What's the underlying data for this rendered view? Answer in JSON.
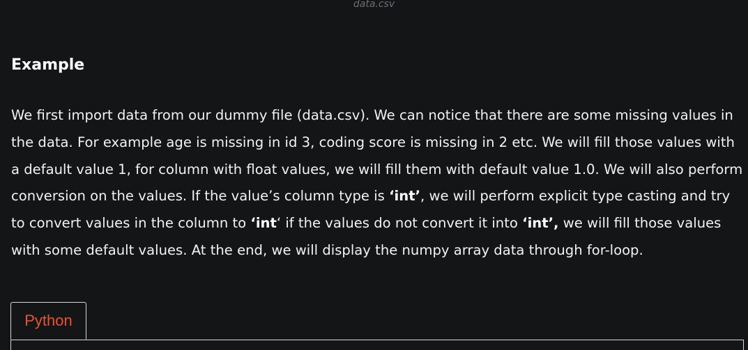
{
  "caption": "data.csv",
  "heading": "Example",
  "paragraph": {
    "parts": [
      "We first import data from our dummy file (data.csv). We can notice that there are some missing values in the data. For example age is missing in id 3, coding score is missing in 2 etc. We will fill those values with a default value 1, for column with float values, we will fill them with default value 1.0. We will also perform conversion on the values. If the value’s column type is ",
      "‘int’",
      ", we will perform explicit type casting and try to convert values in the column to ",
      "‘int",
      "‘ if the values do not convert it into ",
      "‘int’,",
      " we will fill those values with some default values. At the end, we will display the numpy array data through for-loop."
    ]
  },
  "code_tabs": {
    "active_tab": "Python"
  },
  "colors": {
    "background": "#141517",
    "tab_label": "#e8542f",
    "border": "#d9d9d9"
  }
}
